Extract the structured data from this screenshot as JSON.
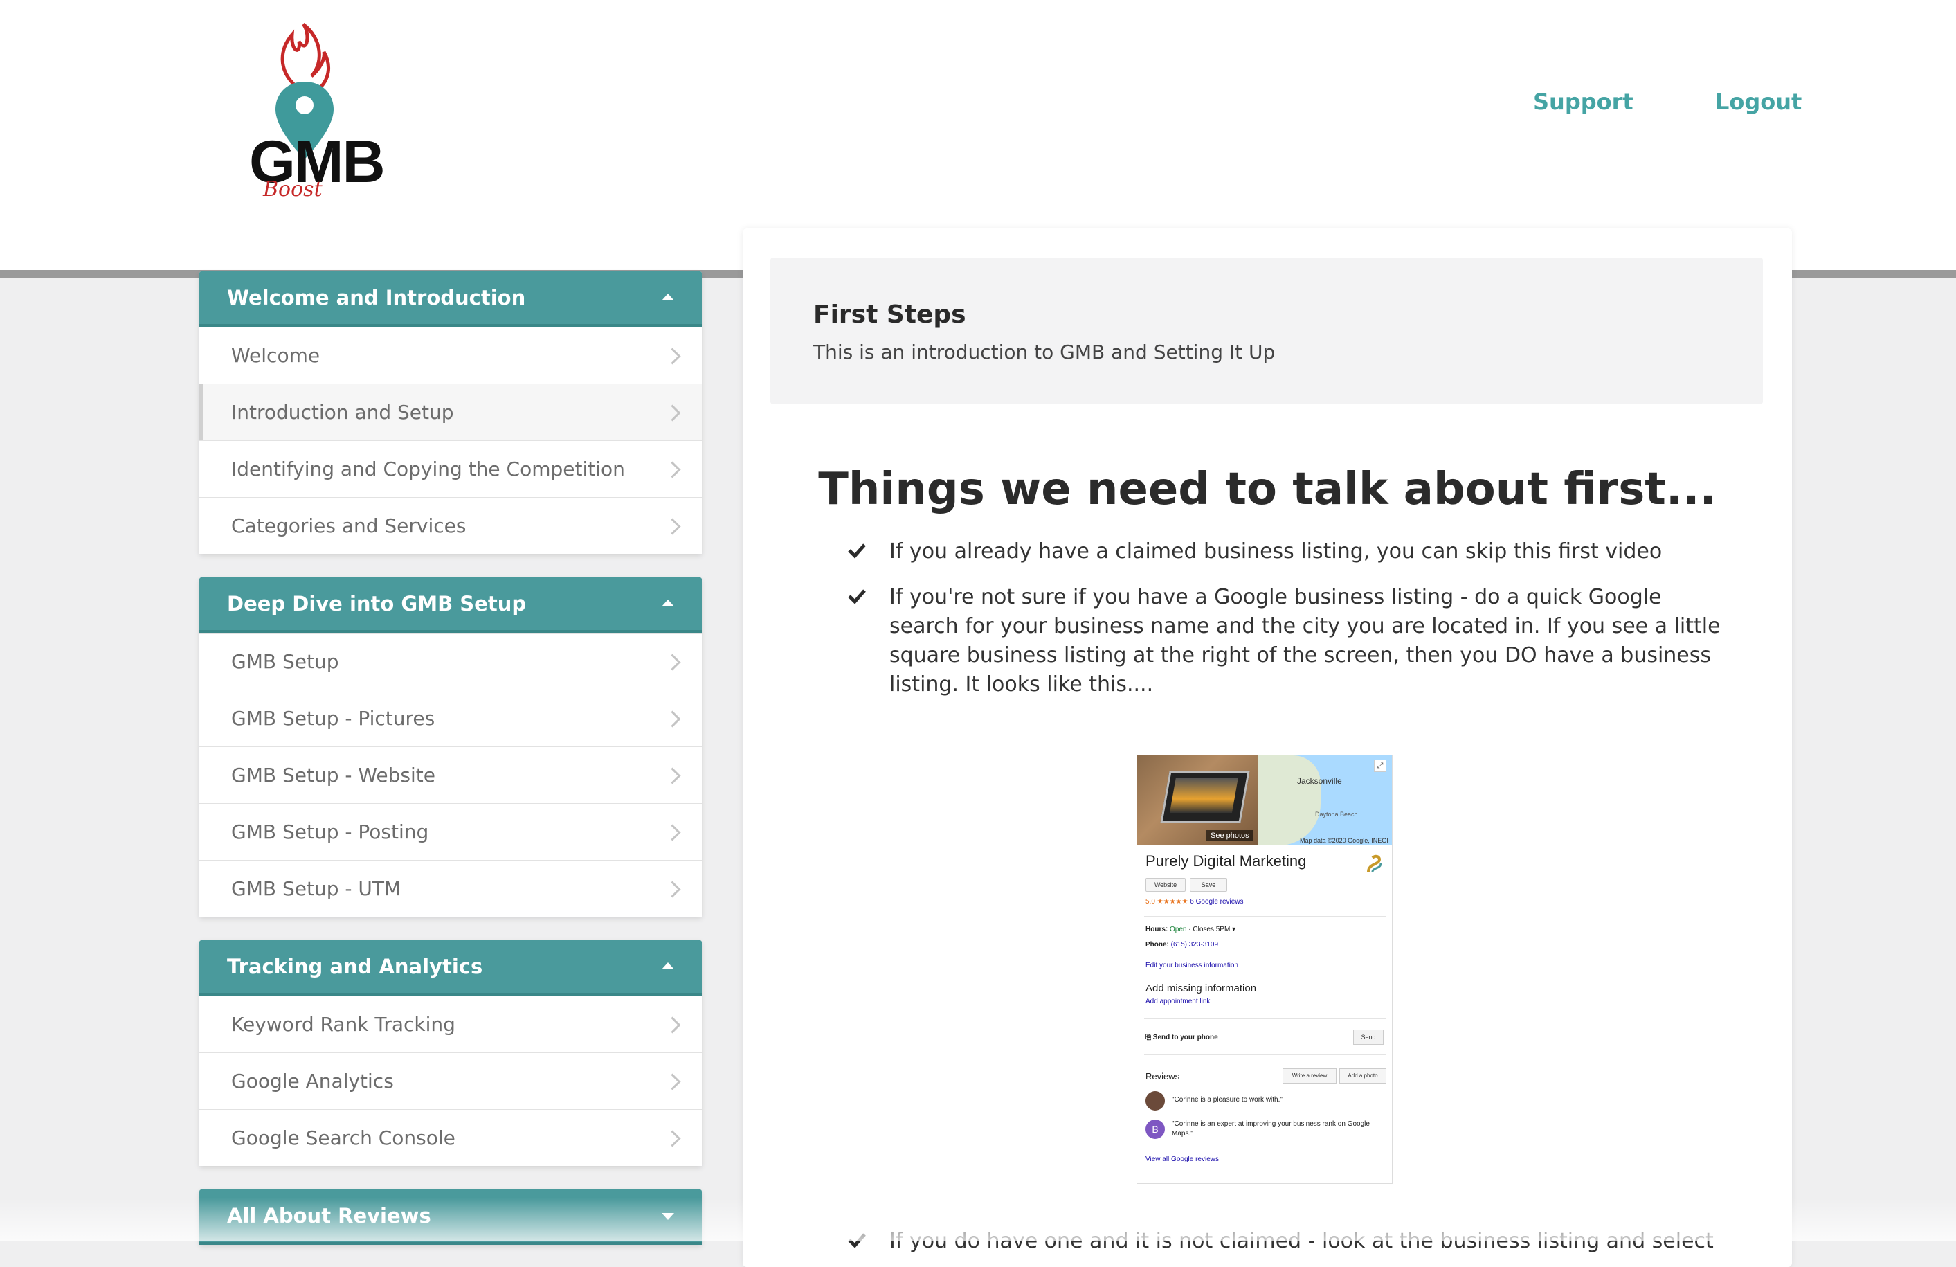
{
  "header": {
    "logo_text": "GMB",
    "logo_subtext": "Boost",
    "nav": {
      "support": "Support",
      "logout": "Logout"
    }
  },
  "sidebar": {
    "modules": [
      {
        "title": "Welcome and Introduction",
        "expanded": true,
        "lessons": [
          "Welcome",
          "Introduction and Setup",
          "Identifying and Copying the Competition",
          "Categories and Services"
        ]
      },
      {
        "title": "Deep Dive into GMB Setup",
        "expanded": true,
        "lessons": [
          "GMB Setup",
          "GMB Setup - Pictures",
          "GMB Setup - Website",
          "GMB Setup - Posting",
          "GMB Setup - UTM"
        ]
      },
      {
        "title": "Tracking and Analytics",
        "expanded": true,
        "lessons": [
          "Keyword Rank Tracking",
          "Google Analytics",
          "Google Search Console"
        ]
      },
      {
        "title": "All About Reviews",
        "expanded": false,
        "lessons": []
      }
    ],
    "active_lesson": "Introduction and Setup"
  },
  "lesson": {
    "title": "First Steps",
    "subtitle": "This is an introduction to GMB and Setting It Up",
    "heading": "Things we need to talk about first...",
    "bullets": [
      "If you already have a claimed business listing, you can skip this first video",
      "If you're not sure if you have a Google business listing - do a quick Google search for your business name and the city you are located in. If you see a little square business listing at the right of the screen, then you DO have a business listing. It looks like this....",
      "If you do have one and it is not claimed - look at the business listing and select"
    ]
  },
  "business_panel": {
    "see_photos": "See photos",
    "map_city": "Jacksonville",
    "map_beach": "Daytona Beach",
    "map_credit": "Map data ©2020 Google, INEGI",
    "name": "Purely Digital Marketing",
    "website_btn": "Website",
    "save_btn": "Save",
    "rating": "5.0 ★★★★★",
    "reviews_link": "6 Google reviews",
    "hours_label": "Hours:",
    "hours_status": "Open",
    "hours_close": "· Closes 5PM ▾",
    "phone_label": "Phone:",
    "phone": "(615) 323-3109",
    "edit_link": "Edit your business information",
    "missing_info": "Add missing information",
    "appt_link": "Add appointment link",
    "send_to_phone": "⎘ Send to your phone",
    "send_btn": "Send",
    "reviews_title": "Reviews",
    "write_review": "Write a review",
    "add_photo": "Add a photo",
    "review1": "\"Corinne is a pleasure to work with.\"",
    "review2": "\"Corinne is an expert at improving your business rank on Google Maps.\"",
    "review2_avatar": "B",
    "view_all": "View all Google reviews"
  },
  "colors": {
    "accent": "#4a9a9c",
    "nav_link": "#45a4a4",
    "logo_red": "#c62828"
  }
}
